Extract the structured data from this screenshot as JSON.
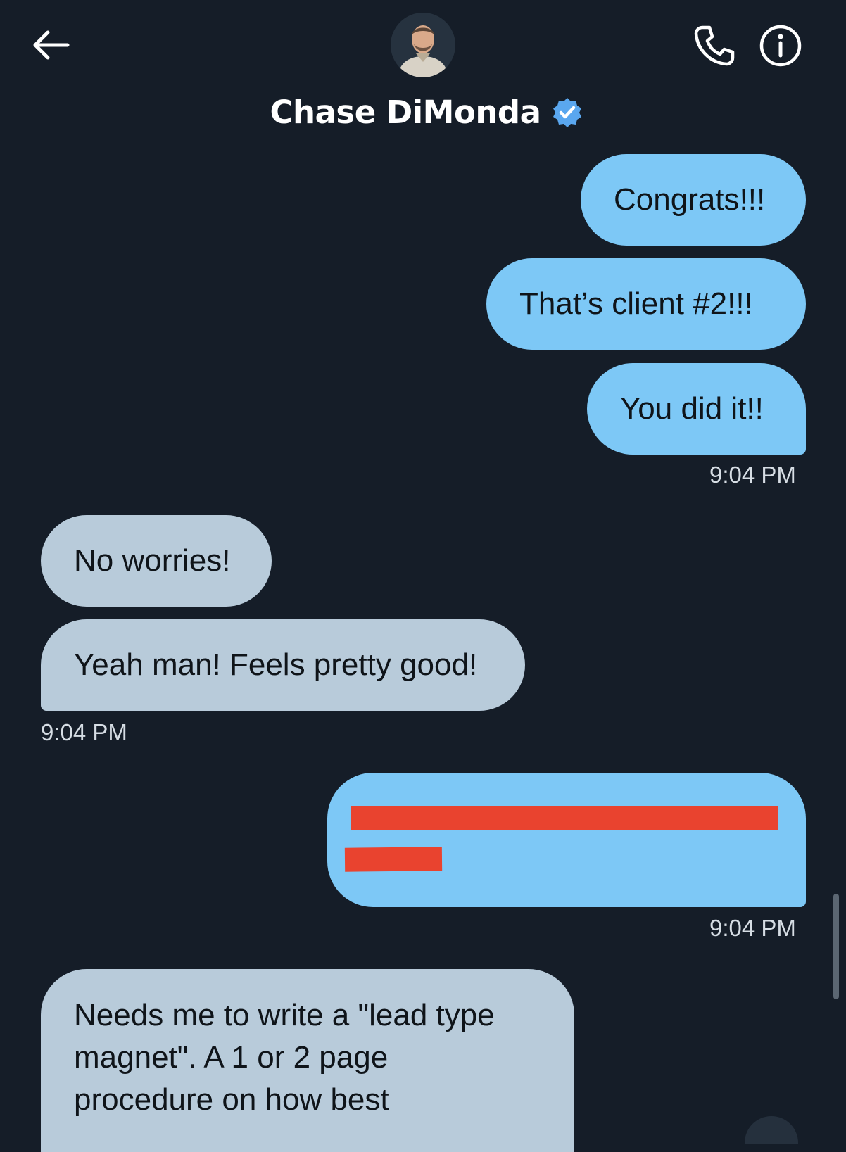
{
  "header": {
    "contact_name": "Chase DiMonda",
    "verified": true
  },
  "colors": {
    "background": "#151d28",
    "sent_bubble": "#7dc8f6",
    "received_bubble": "#b8cbda",
    "verified_badge": "#5aa7ef",
    "redaction": "#e9432f"
  },
  "icons": {
    "back": "arrow-left-icon",
    "call": "phone-icon",
    "info": "info-icon",
    "verified": "verified-badge-icon"
  },
  "messages": [
    {
      "direction": "sent",
      "text": "Congrats!!!"
    },
    {
      "direction": "sent",
      "text": "That’s client #2!!!"
    },
    {
      "direction": "sent",
      "text": "You did it!!"
    },
    {
      "direction": "sent",
      "timestamp": "9:04 PM"
    },
    {
      "direction": "received",
      "text": "No worries!"
    },
    {
      "direction": "received",
      "text": "Yeah man! Feels pretty good!"
    },
    {
      "direction": "received",
      "timestamp": "9:04 PM"
    },
    {
      "direction": "sent",
      "text": "",
      "redacted": true
    },
    {
      "direction": "sent",
      "timestamp": "9:04 PM"
    },
    {
      "direction": "received",
      "lines": [
        "Needs me to write a \"lead type",
        "magnet\".  A 1 or 2 page",
        "procedure on how best"
      ]
    }
  ]
}
